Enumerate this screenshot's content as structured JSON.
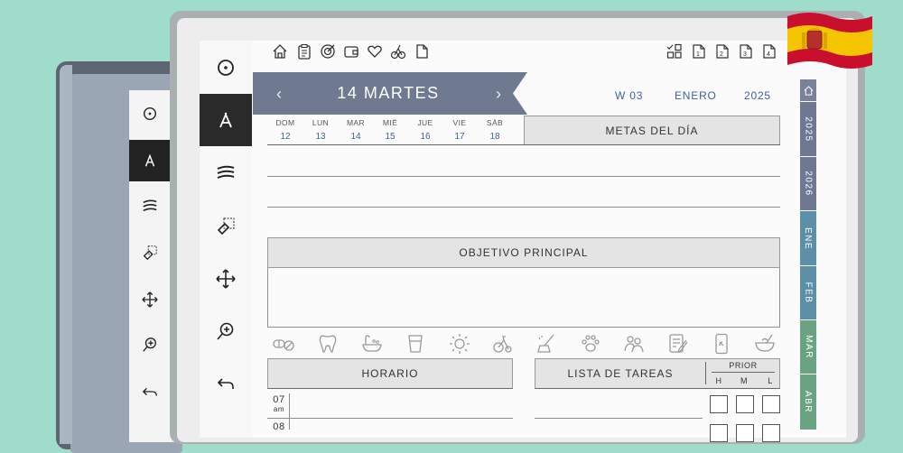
{
  "colors": {
    "background": "#9fdcc9",
    "banner": "#6f7a91",
    "accent_blue": "#3d5fa0",
    "tab_home": "#7a8299",
    "tab_years": "#6e7892",
    "tab_months_blue": "#5b90a8",
    "tab_months_green": "#6aa382"
  },
  "top_icons_left": [
    "home-icon",
    "clipboard-icon",
    "target-icon",
    "wallet-icon",
    "heart-icon",
    "habit-icon",
    "note-icon"
  ],
  "top_icons_right": [
    "grid-check-icon",
    "page-1-icon",
    "page-2-icon",
    "page-3-icon",
    "page-4-icon"
  ],
  "tools": [
    "pen-icon",
    "marker-icon",
    "wave-icon",
    "eraser-icon",
    "move-icon",
    "zoom-icon",
    "undo-icon"
  ],
  "header": {
    "prev": "‹",
    "date": "14 MARTES",
    "next": "›",
    "week": "W 03",
    "month": "ENERO",
    "year": "2025"
  },
  "week_strip": [
    {
      "day": "DOM",
      "num": "12"
    },
    {
      "day": "LUN",
      "num": "13"
    },
    {
      "day": "MAR",
      "num": "14"
    },
    {
      "day": "MIÉ",
      "num": "15"
    },
    {
      "day": "JUE",
      "num": "16"
    },
    {
      "day": "VIE",
      "num": "17"
    },
    {
      "day": "SÁB",
      "num": "18"
    }
  ],
  "sections": {
    "goals": "METAS DEL DÍA",
    "main_objective": "OBJETIVO PRINCIPAL",
    "schedule": "HORARIO",
    "tasks": "LISTA DE TAREAS",
    "priority": "PRIOR",
    "priority_cols": [
      "H",
      "M",
      "L"
    ]
  },
  "habits": [
    "pills-icon",
    "tooth-icon",
    "bath-icon",
    "glass-icon",
    "sun-icon",
    "bike-icon",
    "cleaning-icon",
    "paw-icon",
    "people-icon",
    "journal-icon",
    "phone-icon",
    "bowl-icon"
  ],
  "schedule_rows": [
    {
      "hour": "07",
      "ampm": "am"
    },
    {
      "hour": "08",
      "ampm": ""
    }
  ],
  "side_tabs": [
    "2025",
    "2026",
    "ENE",
    "FEB",
    "MAR",
    "ABR"
  ]
}
